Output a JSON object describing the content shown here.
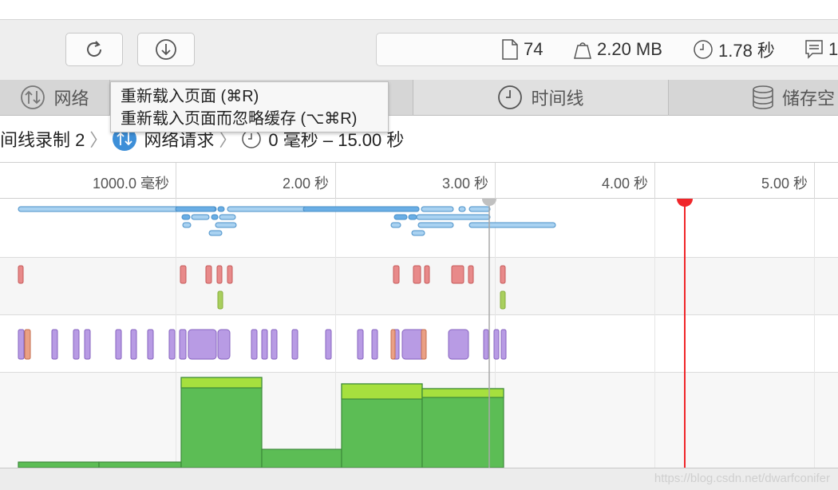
{
  "toolbar": {
    "reload_button": "reload-icon",
    "download_button": "download-icon",
    "stats": {
      "resources": "74",
      "size": "2.20 MB",
      "time": "1.78 秒",
      "console": "1"
    }
  },
  "tabs": [
    {
      "label": "网络",
      "icon": "network-icon"
    },
    {
      "label": "时间线",
      "icon": "clock-icon"
    },
    {
      "label": "储存空",
      "icon": "database-icon"
    }
  ],
  "tooltip": {
    "line1": "重新载入页面 (⌘R)",
    "line2": "重新载入页面而忽略缓存 (⌥⌘R)"
  },
  "breadcrumb": {
    "recording": "间线录制 2",
    "network": "网络请求",
    "range": "0 毫秒 – 15.00 秒"
  },
  "ruler": {
    "ticks": [
      "1000.0 毫秒",
      "2.00 秒",
      "3.00 秒",
      "4.00 秒",
      "5.00 秒"
    ]
  },
  "status": {
    "watermark": "https://blog.csdn.net/dwarfconifer"
  },
  "colors": {
    "network_bar": "#8ec3ea",
    "layout_red": "#e88a8a",
    "rendering_green": "#a9cf5e",
    "script_purple": "#b89be4",
    "frames_green": "#5cbd55",
    "current_time": "#f0262a"
  },
  "timeline": {
    "current_time_marker_sec": 4.18,
    "selection_end_sec": 2.96
  }
}
